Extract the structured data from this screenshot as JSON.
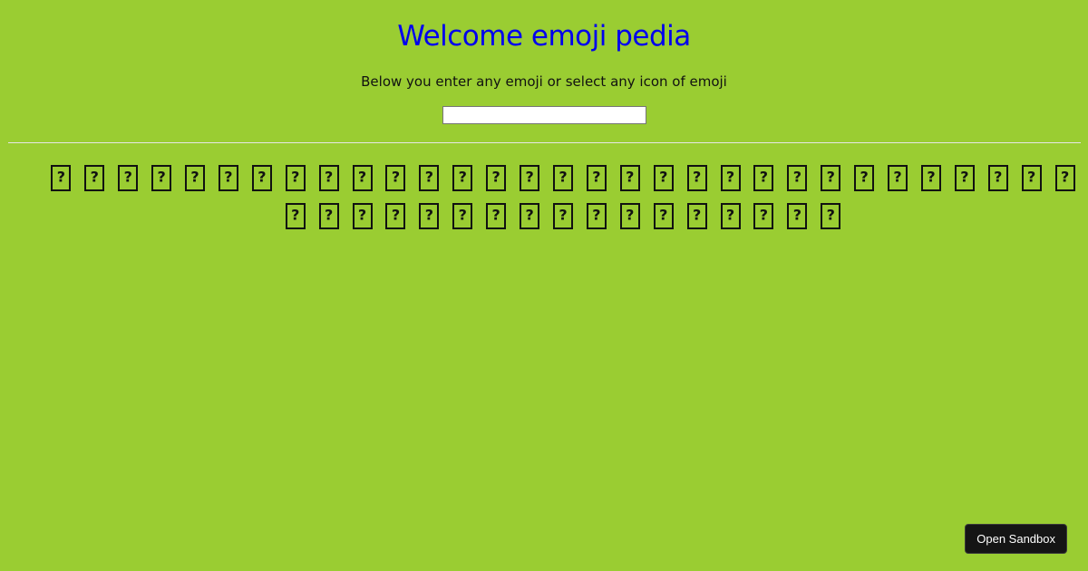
{
  "page": {
    "background": "#9acd32"
  },
  "header": {
    "title": "Welcome emoji pedia",
    "title_color": "#0000ee",
    "subtitle": "Below you enter any emoji or select any icon of emoji"
  },
  "search": {
    "value": "",
    "placeholder": ""
  },
  "emojis": {
    "glyph_note": "unrenderable-emoji-icon",
    "count": 48
  },
  "footer": {
    "sandbox_label": "Open Sandbox",
    "sandbox_bg": "#151515"
  }
}
